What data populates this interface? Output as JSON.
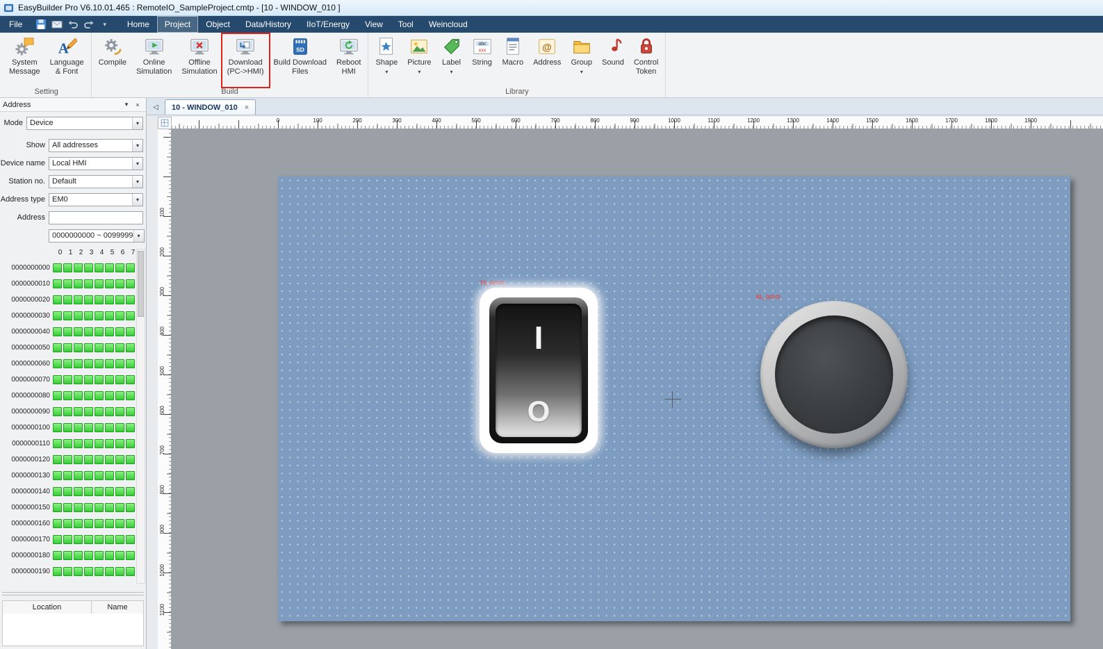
{
  "titlebar": {
    "title": "EasyBuilder Pro V6.10.01.465 : RemoteIO_SampleProject.cmtp - [10 - WINDOW_010 ]"
  },
  "menubar": {
    "file_label": "File",
    "tabs": [
      {
        "label": "Home"
      },
      {
        "label": "Project",
        "active": true
      },
      {
        "label": "Object"
      },
      {
        "label": "Data/History"
      },
      {
        "label": "IIoT/Energy"
      },
      {
        "label": "View"
      },
      {
        "label": "Tool"
      },
      {
        "label": "Weincloud"
      }
    ]
  },
  "ribbon": {
    "groups": [
      {
        "label": "Setting",
        "buttons": [
          {
            "name": "system-message-button",
            "icon": "system-message-icon",
            "lines": [
              "System",
              "Message"
            ]
          },
          {
            "name": "language-font-button",
            "icon": "language-font-icon",
            "lines": [
              "Language",
              "& Font"
            ]
          }
        ]
      },
      {
        "label": "Build",
        "buttons": [
          {
            "name": "compile-button",
            "icon": "compile-icon",
            "lines": [
              "Compile"
            ]
          },
          {
            "name": "online-simulation-button",
            "icon": "online-simulation-icon",
            "lines": [
              "Online",
              "Simulation"
            ]
          },
          {
            "name": "offline-simulation-button",
            "icon": "offline-simulation-icon",
            "lines": [
              "Offline",
              "Simulation"
            ]
          },
          {
            "name": "download-button",
            "icon": "download-icon",
            "lines": [
              "Download",
              "(PC->HMI)"
            ],
            "highlight": true
          },
          {
            "name": "build-download-files-button",
            "icon": "build-download-files-icon",
            "lines": [
              "Build Download",
              "Files"
            ]
          },
          {
            "name": "reboot-hmi-button",
            "icon": "reboot-hmi-icon",
            "lines": [
              "Reboot",
              "HMI"
            ]
          }
        ]
      },
      {
        "label": "Library",
        "buttons": [
          {
            "name": "shape-button",
            "icon": "shape-icon",
            "lines": [
              "Shape"
            ],
            "caret": true
          },
          {
            "name": "picture-button",
            "icon": "picture-icon",
            "lines": [
              "Picture"
            ],
            "caret": true
          },
          {
            "name": "label-button",
            "icon": "label-icon",
            "lines": [
              "Label"
            ],
            "caret": true
          },
          {
            "name": "string-button",
            "icon": "string-icon",
            "lines": [
              "String"
            ]
          },
          {
            "name": "macro-button",
            "icon": "macro-icon",
            "lines": [
              "Macro"
            ]
          },
          {
            "name": "address-button",
            "icon": "address-icon",
            "lines": [
              "Address"
            ]
          },
          {
            "name": "group-button",
            "icon": "group-icon",
            "lines": [
              "Group"
            ],
            "caret": true
          },
          {
            "name": "sound-button",
            "icon": "sound-icon",
            "lines": [
              "Sound"
            ]
          },
          {
            "name": "control-token-button",
            "icon": "control-token-icon",
            "lines": [
              "Control",
              "Token"
            ]
          }
        ]
      }
    ]
  },
  "address_panel": {
    "title": "Address",
    "mode": {
      "label": "Mode",
      "value": "Device"
    },
    "fields": [
      {
        "label": "Show",
        "value": "All addresses",
        "type": "select"
      },
      {
        "label": "Device name",
        "value": "Local HMI",
        "type": "select"
      },
      {
        "label": "Station no.",
        "value": "Default",
        "type": "select"
      },
      {
        "label": "Address type",
        "value": "EM0",
        "type": "select"
      },
      {
        "label": "Address",
        "value": "",
        "type": "input"
      }
    ],
    "range": "0000000000 ~ 0099999",
    "grid": {
      "col_headers": [
        "0",
        "1",
        "2",
        "3",
        "4",
        "5",
        "6",
        "7"
      ],
      "rows": [
        "0000000000",
        "0000000010",
        "0000000020",
        "0000000030",
        "0000000040",
        "0000000050",
        "0000000060",
        "0000000070",
        "0000000080",
        "0000000090",
        "0000000100",
        "0000000110",
        "0000000120",
        "0000000130",
        "0000000140",
        "0000000150",
        "0000000160",
        "0000000170",
        "0000000180",
        "0000000190"
      ]
    },
    "bottom": {
      "location": "Location",
      "name": "Name"
    }
  },
  "canvas": {
    "tab": {
      "label": "10 - WINDOW_010"
    },
    "hruler": [
      "0",
      "100",
      "200",
      "300",
      "400",
      "500",
      "600",
      "700",
      "800",
      "900",
      "1000",
      "1100",
      "1200",
      "1300",
      "1400",
      "1500",
      "1600",
      "1700",
      "1800",
      "1900"
    ],
    "vruler": [
      "100",
      "200",
      "300",
      "400",
      "500",
      "600",
      "700",
      "800",
      "900",
      "1000",
      "1100"
    ],
    "toggle_switch": {
      "label": "TS_0(0:0)",
      "on_symbol": "I",
      "off_symbol": "O"
    },
    "round_button": {
      "label": "BL_0(0:0)"
    }
  },
  "glyphs": {
    "caret_down": "▾",
    "close": "×",
    "nav_left": "◁"
  },
  "colors": {
    "highlight": "#e0241c",
    "menubar": "#264a6d",
    "canvas": "#7d9cc0",
    "bit_on": "#35cd35"
  }
}
